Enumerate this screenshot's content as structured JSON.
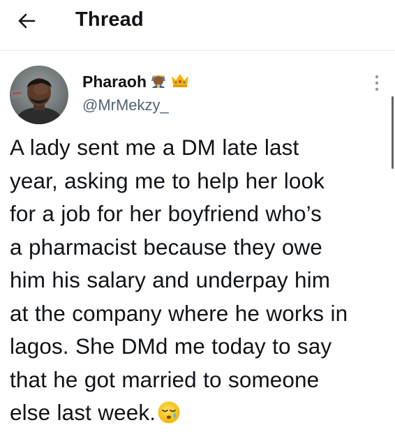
{
  "header": {
    "title": "Thread",
    "back_icon": "arrow-left-icon"
  },
  "author": {
    "display_name": "Pharaoh",
    "name_emojis": [
      "pharaoh-emoji-icon",
      "crown-emoji-icon"
    ],
    "handle": "@MrMekzy_",
    "avatar_icon": "avatar-photo"
  },
  "tweet": {
    "lines": [
      "A lady sent me a DM late last",
      "year, asking me to help her look",
      "for a job for her boyfriend who’s",
      "a pharmacist because they owe",
      "him his salary and underpay him",
      "at the company where he works in",
      "lagos. She DMd me today to say",
      "that he got married to someone",
      "else last week."
    ],
    "trailing_emoji": "sleepy-face-emoji-icon"
  },
  "colors": {
    "text": "#0f1419",
    "secondary": "#536471",
    "divider": "#e6e9ec",
    "crown": "#f5b300"
  }
}
